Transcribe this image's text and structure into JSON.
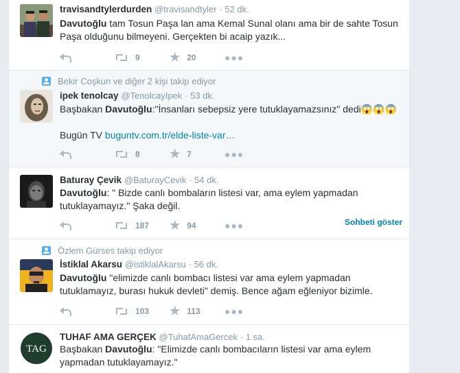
{
  "tweets": [
    {
      "context": "",
      "name": "travisandtylerdurden",
      "handle": "@travisandtyler",
      "time": "· 52 dk.",
      "line1_bold": "Davutoğlu",
      "line1_rest": " tam Tosun Paşa lan ama Kemal Sunal olanı ama bir de sahte Tosun",
      "line2": "Paşa olduğunu bilmeyeni. Gerçekten bi acaip yazık...",
      "retweets": "9",
      "favorites": "20",
      "avatar_icon": "two-men-photo-avatar"
    },
    {
      "context": "Bekir Coşkun ve diğer 2 kişi takip ediyor",
      "name": "ipek tenolcay",
      "handle": "@TenolcayIpek",
      "time": "· 53 dk.",
      "line1_pre": "Başbakan ",
      "line1_bold": "Davutoğlu",
      "line1_rest": ":\"İnsanları sebepsiz yere tutuklayamazsınız\" dedi😱😱😱",
      "line3_pre": "Bugün TV ",
      "link": "buguntv.com.tr/elde-liste-var…",
      "retweets": "8",
      "favorites": "7",
      "avatar_icon": "woman-portrait-avatar"
    },
    {
      "context": "",
      "name": "Baturay Çevik",
      "handle": "@BaturayCevik",
      "time": "· 54 dk.",
      "line1_bold": "Davutoğlu",
      "line1_rest": ": \" Bizde canlı bombaların listesi var, ama eylem yapmadan",
      "line2": "tutuklayamayız.\" Şaka değil.",
      "retweets": "187",
      "favorites": "94",
      "conversation": "Sohbeti göster",
      "avatar_icon": "man-dark-portrait-avatar"
    },
    {
      "context": "Özlem Gürses takip ediyor",
      "name": "İstiklal Akarsu",
      "handle": "@istiklalAkarsu",
      "time": "· 56 dk.",
      "line1_bold": "Davutoğlu",
      "line1_rest": " \"elimizde canlı bombacı listesi var ama eylem yapmadan",
      "line2": "tutuklamayız, burası hukuk devleti\" demiş. Bence ağam eğleniyor bizimle.",
      "retweets": "103",
      "favorites": "113",
      "avatar_icon": "man-yellow-background-avatar"
    },
    {
      "context": "",
      "name": "TUHAF AMA GERÇEK",
      "handle": "@TuhafAmaGercek",
      "time": "· 1 sa.",
      "line1_pre": "Başbakan ",
      "line1_bold": "Davutoğlu",
      "line1_rest": ": \"Elimizde canlı bombacıların listesi var ama eylem",
      "line2": "yapmadan tutuklayamayız.\"",
      "avatar_text": "TAG",
      "avatar_icon": "tag-logo-avatar"
    }
  ],
  "colors": {
    "link": "#0084b4",
    "muted": "#8899a6",
    "highlight_bg": "#f5f8fa"
  }
}
